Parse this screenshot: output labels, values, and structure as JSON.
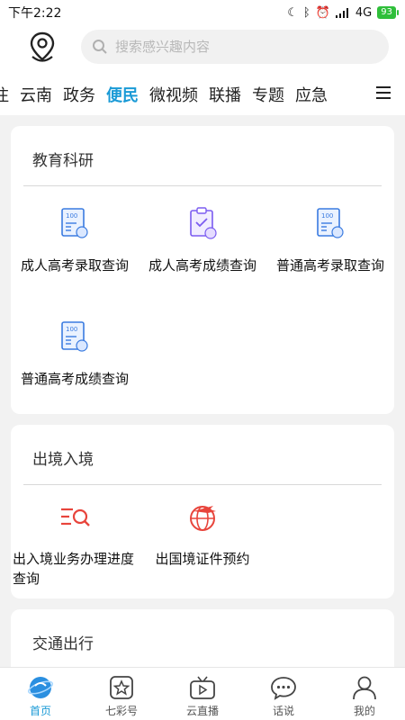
{
  "status_bar": {
    "time": "下午2:22",
    "network": "4G",
    "battery": "93"
  },
  "search": {
    "placeholder": "搜索感兴趣内容"
  },
  "tabs": [
    {
      "label": "注"
    },
    {
      "label": "云南"
    },
    {
      "label": "政务"
    },
    {
      "label": "便民",
      "active": true
    },
    {
      "label": "微视频"
    },
    {
      "label": "联播"
    },
    {
      "label": "专题"
    },
    {
      "label": "应急"
    }
  ],
  "sections": {
    "education": {
      "title": "教育科研",
      "items": [
        {
          "label": "成人高考录取查询",
          "icon": "score-sheet-icon"
        },
        {
          "label": "成人高考成绩查询",
          "icon": "clipboard-check-icon"
        },
        {
          "label": "普通高考录取查询",
          "icon": "score-sheet-icon"
        },
        {
          "label": "普通高考成绩查询",
          "icon": "score-sheet-icon"
        }
      ]
    },
    "exit_entry": {
      "title": "出境入境",
      "items": [
        {
          "label": "出入境业务办理进度查询",
          "icon": "list-search-icon"
        },
        {
          "label": "出国境证件预约",
          "icon": "globe-plane-icon"
        }
      ]
    },
    "transport": {
      "title": "交通出行"
    }
  },
  "bottom_nav": [
    {
      "label": "首页",
      "icon": "home-planet-icon",
      "active": true
    },
    {
      "label": "七彩号",
      "icon": "star-box-icon"
    },
    {
      "label": "云直播",
      "icon": "tv-play-icon"
    },
    {
      "label": "话说",
      "icon": "chat-bubble-icon"
    },
    {
      "label": "我的",
      "icon": "person-icon"
    }
  ],
  "colors": {
    "accent": "#1a9ad6",
    "icon_blue": "#3a7be0",
    "icon_purple": "#7b5cf0",
    "icon_red": "#e8453c"
  }
}
